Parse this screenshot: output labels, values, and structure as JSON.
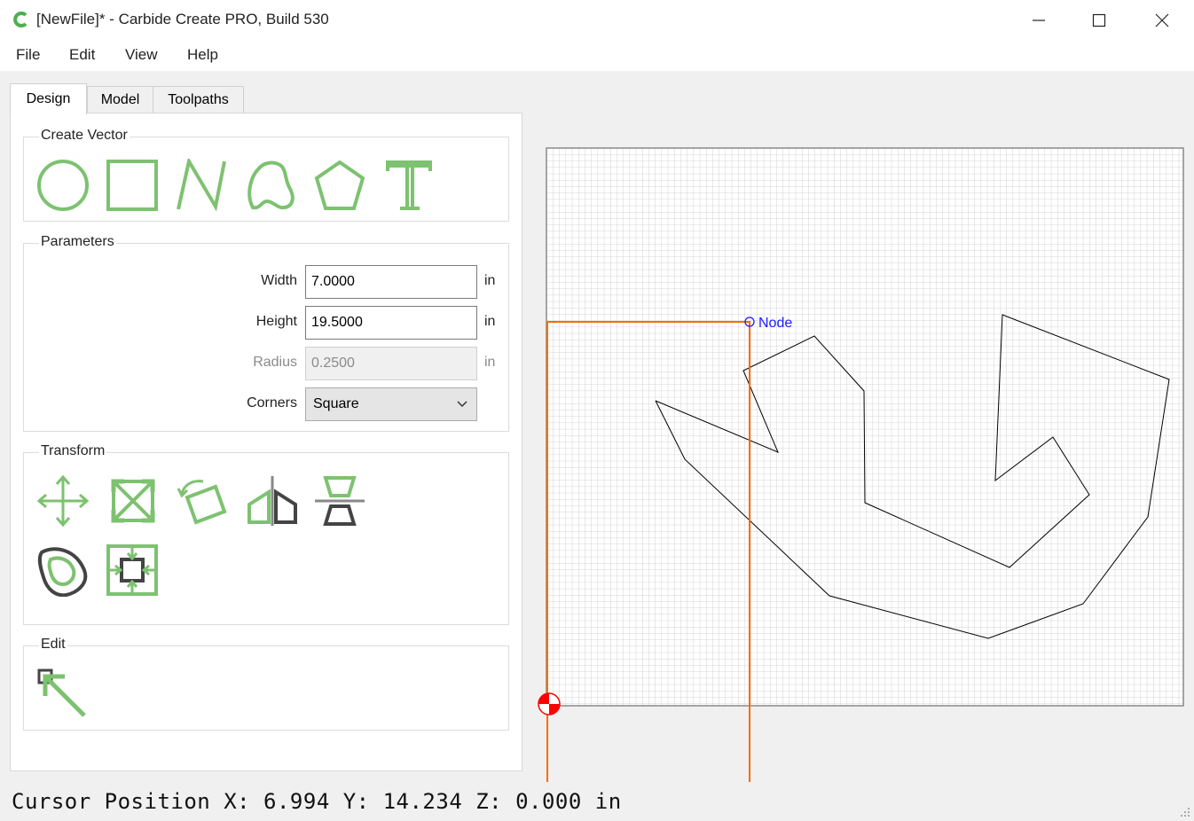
{
  "window": {
    "title": "[NewFile]* - Carbide Create PRO, Build 530",
    "app_icon": "carbide-logo-icon",
    "controls": [
      "minimize-icon",
      "maximize-icon",
      "close-icon"
    ]
  },
  "menu": [
    "File",
    "Edit",
    "View",
    "Help"
  ],
  "tabs": [
    {
      "label": "Design",
      "active": true
    },
    {
      "label": "Model",
      "active": false
    },
    {
      "label": "Toolpaths",
      "active": false
    }
  ],
  "create_vector": {
    "title": "Create Vector",
    "tools": [
      "circle-tool-icon",
      "rectangle-tool-icon",
      "polyline-tool-icon",
      "curve-tool-icon",
      "polygon-tool-icon",
      "text-tool-icon"
    ]
  },
  "parameters": {
    "title": "Parameters",
    "width": {
      "label": "Width",
      "value": "7.0000",
      "unit": "in"
    },
    "height": {
      "label": "Height",
      "value": "19.5000",
      "unit": "in"
    },
    "radius": {
      "label": "Radius",
      "value": "0.2500",
      "unit": "in",
      "disabled": true
    },
    "corners": {
      "label": "Corners",
      "value": "Square"
    }
  },
  "transform": {
    "title": "Transform",
    "tools": [
      "move-tool-icon",
      "scale-tool-icon",
      "rotate-tool-icon",
      "mirror-tool-icon",
      "align-tool-icon",
      "offset-tool-icon",
      "center-tool-icon"
    ]
  },
  "edit": {
    "title": "Edit",
    "tools": [
      "edit-nodes-tool-icon"
    ]
  },
  "canvas": {
    "node_label": "Node"
  },
  "status": {
    "text": "Cursor Position X: 6.994 Y: 14.234 Z: 0.000 in"
  },
  "colors": {
    "accent_green": "#7dc270",
    "guide_orange": "#ff6a00",
    "node_blue": "#1a1aff",
    "origin_red": "#ff0000"
  }
}
